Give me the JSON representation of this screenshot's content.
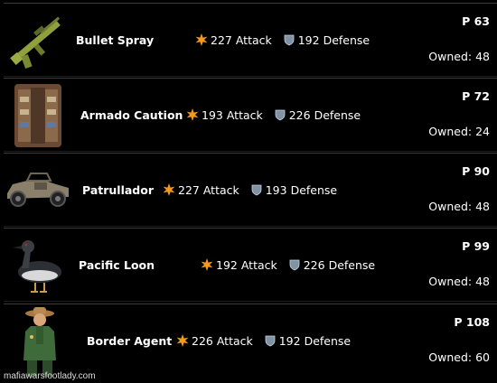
{
  "items": [
    {
      "name": "Bullet Spray",
      "attack": "227 Attack",
      "defense": "192 Defense",
      "price": "P 63",
      "owned": "Owned: 48",
      "icon": "assault-rifle-icon"
    },
    {
      "name": "Armado Caution",
      "attack": "193 Attack",
      "defense": "226 Defense",
      "price": "P 72",
      "owned": "Owned: 24",
      "icon": "armor-vest-icon"
    },
    {
      "name": "Patrullador",
      "attack": "227 Attack",
      "defense": "193 Defense",
      "price": "P 90",
      "owned": "Owned: 48",
      "icon": "buggy-vehicle-icon"
    },
    {
      "name": "Pacific Loon",
      "attack": "192 Attack",
      "defense": "226 Defense",
      "price": "P 99",
      "owned": "Owned: 48",
      "icon": "loon-bird-icon"
    },
    {
      "name": "Border Agent",
      "attack": "226 Attack",
      "defense": "192 Defense",
      "price": "P 108",
      "owned": "Owned: 60",
      "icon": "border-agent-icon"
    }
  ],
  "watermark": "mafiawarsfootlady.com",
  "colors": {
    "attack_icon": "#f29a1c",
    "defense_icon": "#7f93a6",
    "background": "#000000"
  }
}
